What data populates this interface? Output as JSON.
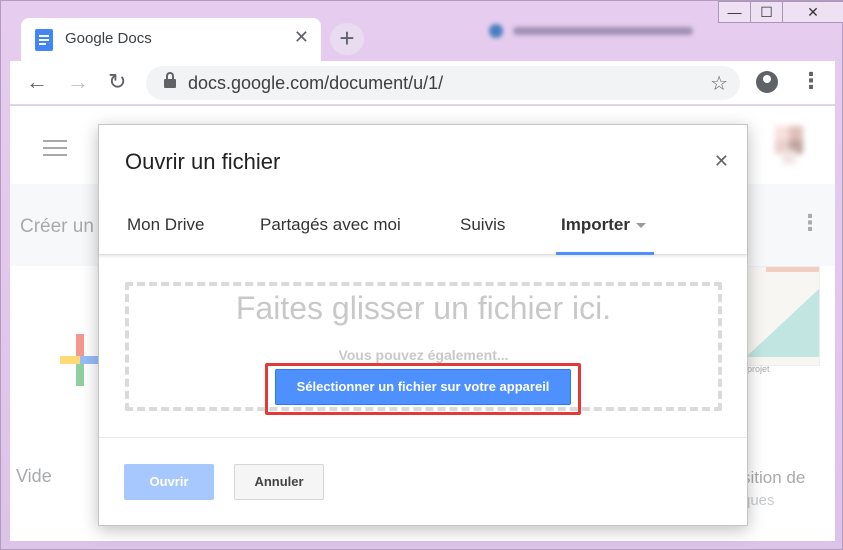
{
  "browser": {
    "tab_title": "Google Docs",
    "tab_close": "✕",
    "new_tab": "+",
    "url": "docs.google.com/document/u/1/",
    "window_buttons": {
      "minimize": "—",
      "maximize": "☐",
      "close": "✕"
    },
    "back": "←",
    "forward": "→",
    "reload": "↻",
    "bookmark_star": "☆",
    "menu": "⋮"
  },
  "page": {
    "create_label": "Créer un",
    "blank_label": "Vide",
    "right_thumb_caption": "projet",
    "right_label_line1": "sition de",
    "right_label_line2": "ques",
    "more": "⋮"
  },
  "dialog": {
    "title": "Ouvrir un fichier",
    "close": "✕",
    "tabs": [
      {
        "label": "Mon Drive",
        "active": false
      },
      {
        "label": "Partagés avec moi",
        "active": false
      },
      {
        "label": "Suivis",
        "active": false
      },
      {
        "label": "Importer",
        "active": true
      }
    ],
    "drop_text": "Faites glisser un fichier ici.",
    "also_text": "Vous pouvez également...",
    "select_button": "Sélectionner un fichier sur votre appareil",
    "open_button": "Ouvrir",
    "cancel_button": "Annuler"
  },
  "colors": {
    "accent": "#4d90fe",
    "highlight": "#e53935",
    "open_disabled": "#a6c8ff"
  }
}
